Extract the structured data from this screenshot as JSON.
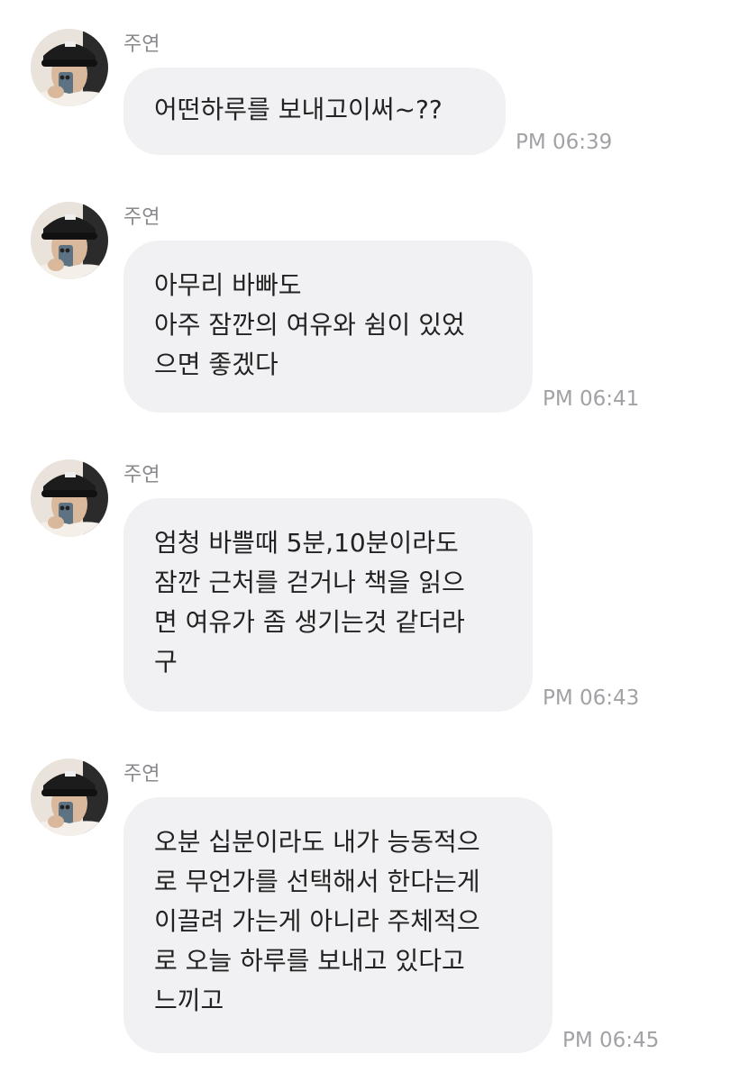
{
  "messages": [
    {
      "sender": "주연",
      "lines": [
        "어떤하루를 보내고이써~??"
      ],
      "time": "PM 06:39"
    },
    {
      "sender": "주연",
      "lines": [
        "아무리 바빠도",
        "아주 잠깐의 여유와 쉼이 있었",
        "으면 좋겠다"
      ],
      "time": "PM 06:41"
    },
    {
      "sender": "주연",
      "lines": [
        "엄청 바쁠때 5분,10분이라도",
        "잠깐 근처를 걷거나 책을 읽으",
        "면 여유가 좀 생기는것 같더라",
        "구"
      ],
      "time": "PM 06:43"
    },
    {
      "sender": "주연",
      "lines": [
        "오분 십분이라도 내가 능동적으",
        "로 무언가를 선택해서 한다는게",
        "이끌려 가는게 아니라 주체적으",
        "로 오늘 하루를 보내고 있다고",
        "느끼고"
      ],
      "time": "PM 06:45"
    }
  ],
  "icons": {
    "avatar": "profile-photo"
  },
  "colors": {
    "bubble_bg": "#f1f1f3",
    "message_text": "#222222",
    "sender_text": "#8a8a8e",
    "time_text": "#a2a2a6"
  }
}
